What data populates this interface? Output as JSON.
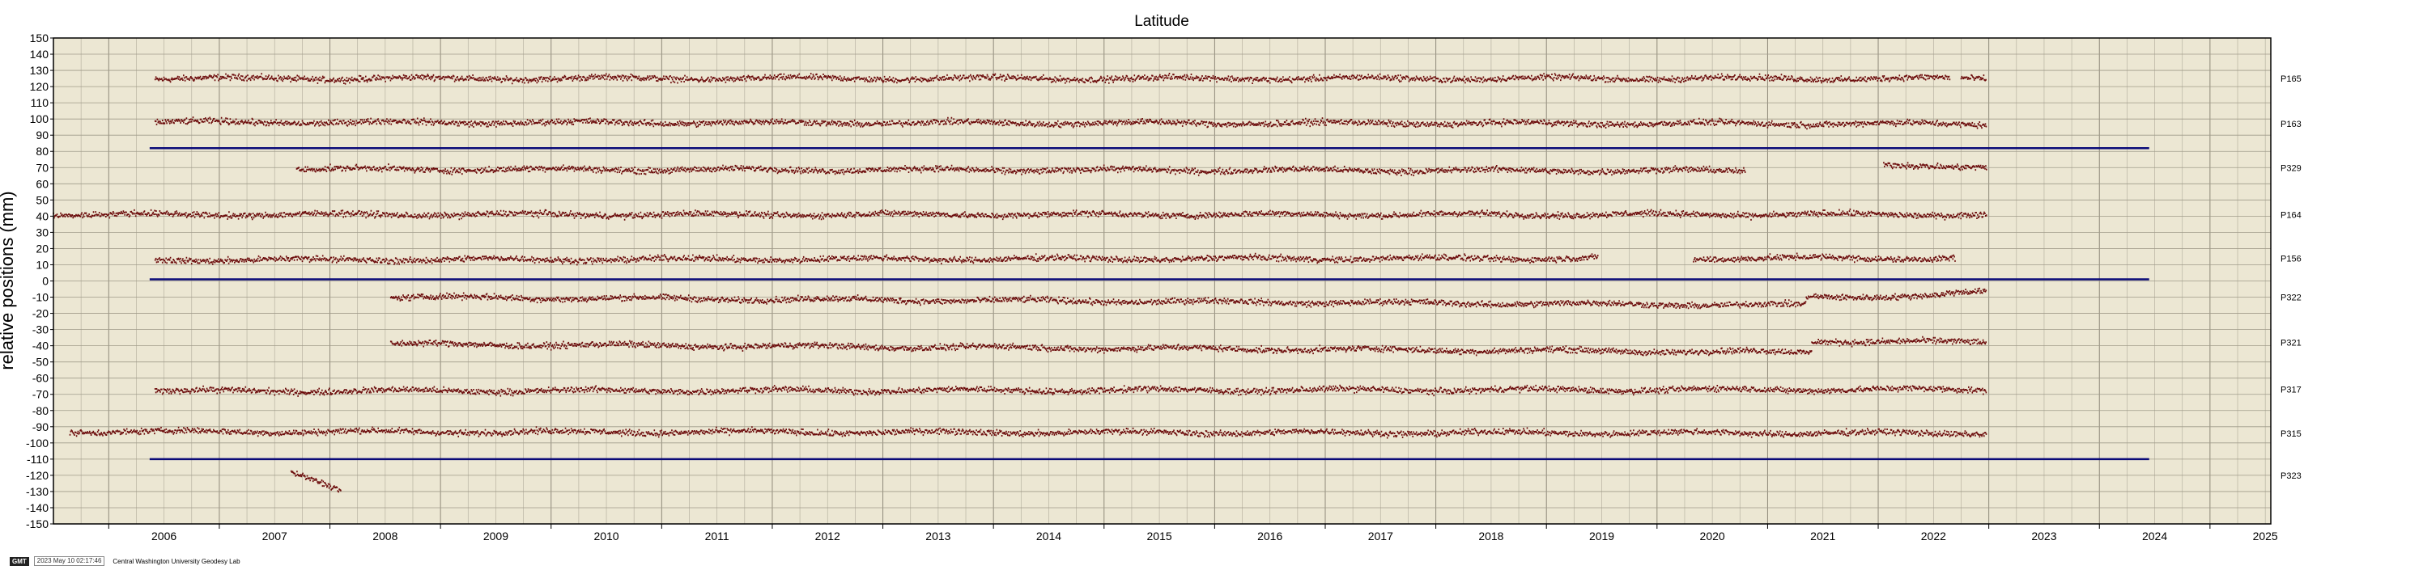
{
  "chart_data": {
    "type": "scatter",
    "title": "Latitude",
    "ylabel": "relative positions (mm)",
    "xlabel": "",
    "xlim": [
      2005.5,
      2025.55
    ],
    "ylim": [
      -150,
      150
    ],
    "x_ticks": [
      "2006",
      "2007",
      "2008",
      "2009",
      "2010",
      "2011",
      "2012",
      "2013",
      "2014",
      "2015",
      "2016",
      "2017",
      "2018",
      "2019",
      "2020",
      "2021",
      "2022",
      "2023",
      "2024",
      "2025"
    ],
    "y_ticks": [
      "150",
      "140",
      "130",
      "120",
      "110",
      "100",
      "90",
      "80",
      "70",
      "60",
      "50",
      "40",
      "30",
      "20",
      "10",
      "0",
      "-10",
      "-20",
      "-30",
      "-40",
      "-50",
      "-60",
      "-70",
      "-80",
      "-90",
      "-100",
      "-110",
      "-120",
      "-130",
      "-140",
      "-150"
    ],
    "grid": true,
    "point_color": "#6b0a0a",
    "error_color": "#bdbdbd",
    "background_color": "#ece7d3",
    "separator_color": "#0a0a78",
    "separator_lines": [
      {
        "y": 82,
        "x_start": 2006.37,
        "x_end": 2024.45
      },
      {
        "y": 1,
        "x_start": 2006.37,
        "x_end": 2024.45
      },
      {
        "y": -110,
        "x_start": 2006.37,
        "x_end": 2024.45
      }
    ],
    "series": [
      {
        "name": "P165",
        "offset": 125,
        "segments": [
          {
            "x0": 2006.42,
            "x1": 2022.65,
            "y0": 125,
            "y1": 125
          },
          {
            "x0": 2022.75,
            "x1": 2022.98,
            "y0": 125,
            "y1": 125
          }
        ]
      },
      {
        "name": "P163",
        "offset": 97,
        "segments": [
          {
            "x0": 2006.42,
            "x1": 2022.98,
            "y0": 98,
            "y1": 97
          }
        ]
      },
      {
        "name": "P329",
        "offset": 70,
        "segments": [
          {
            "x0": 2007.7,
            "x1": 2020.8,
            "y0": 69,
            "y1": 68
          },
          {
            "x0": 2022.05,
            "x1": 2022.98,
            "y0": 71,
            "y1": 71
          }
        ]
      },
      {
        "name": "P164",
        "offset": 41,
        "segments": [
          {
            "x0": 2005.5,
            "x1": 2022.98,
            "y0": 41,
            "y1": 41
          }
        ]
      },
      {
        "name": "P156",
        "offset": 14,
        "segments": [
          {
            "x0": 2006.42,
            "x1": 2019.47,
            "y0": 13,
            "y1": 14
          },
          {
            "x0": 2020.33,
            "x1": 2022.7,
            "y0": 14,
            "y1": 14
          }
        ]
      },
      {
        "name": "P322",
        "offset": -10,
        "segments": [
          {
            "x0": 2008.55,
            "x1": 2021.35,
            "y0": -10,
            "y1": -15
          },
          {
            "x0": 2021.35,
            "x1": 2022.62,
            "y0": -10,
            "y1": -9
          },
          {
            "x0": 2022.62,
            "x1": 2022.98,
            "y0": -8,
            "y1": -7
          }
        ]
      },
      {
        "name": "P321",
        "offset": -38,
        "segments": [
          {
            "x0": 2008.55,
            "x1": 2021.4,
            "y0": -39,
            "y1": -44
          },
          {
            "x0": 2021.4,
            "x1": 2022.98,
            "y0": -37,
            "y1": -38
          }
        ]
      },
      {
        "name": "P317",
        "offset": -67,
        "segments": [
          {
            "x0": 2006.42,
            "x1": 2022.98,
            "y0": -68,
            "y1": -67
          }
        ]
      },
      {
        "name": "P315",
        "offset": -94,
        "segments": [
          {
            "x0": 2005.65,
            "x1": 2022.98,
            "y0": -93,
            "y1": -94
          }
        ]
      },
      {
        "name": "P323",
        "offset": -120,
        "segments": [
          {
            "x0": 2007.65,
            "x1": 2008.1,
            "y0": -118,
            "y1": -130
          }
        ]
      }
    ]
  },
  "footer": {
    "logo": "GMT",
    "timestamp": "2023 May 10 02:17:46",
    "lab_name": "Central Washington University Geodesy Lab"
  }
}
